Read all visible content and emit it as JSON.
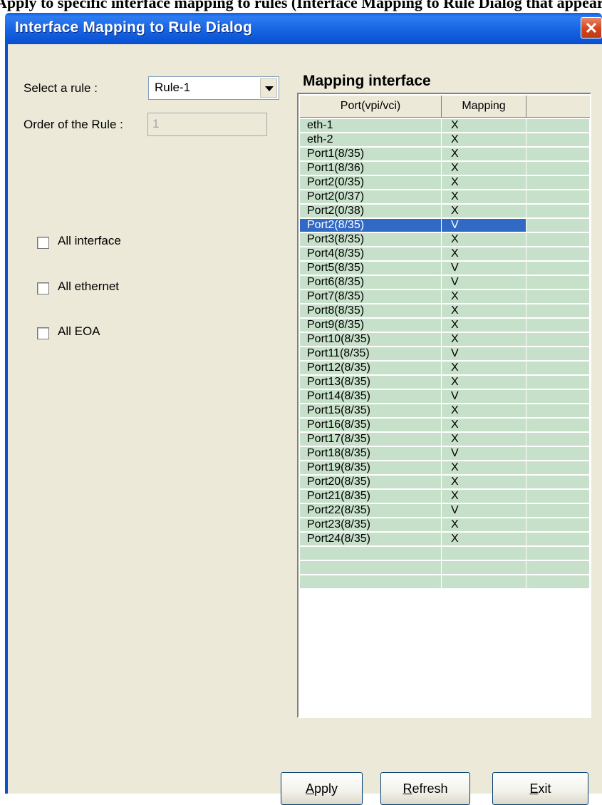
{
  "top_strip_text": "Apply to specific interface mapping to rules (Interface Mapping to Rule Dialog that appears)",
  "dialog": {
    "title": "Interface Mapping to Rule Dialog",
    "close_glyph": "✕"
  },
  "form": {
    "select_rule_label": "Select a rule :",
    "select_rule_value": "Rule-1",
    "order_label": "Order of the Rule :",
    "order_value": "1",
    "checkboxes": [
      {
        "label": "All interface",
        "checked": false
      },
      {
        "label": "All ethernet",
        "checked": false
      },
      {
        "label": "All EOA",
        "checked": false
      }
    ]
  },
  "mapping": {
    "title": "Mapping interface",
    "columns": [
      "Port(vpi/vci)",
      "Mapping",
      ""
    ],
    "selected_index": 7,
    "rows": [
      {
        "port": "eth-1",
        "mapping": "X"
      },
      {
        "port": "eth-2",
        "mapping": "X"
      },
      {
        "port": "Port1(8/35)",
        "mapping": "X"
      },
      {
        "port": "Port1(8/36)",
        "mapping": "X"
      },
      {
        "port": "Port2(0/35)",
        "mapping": "X"
      },
      {
        "port": "Port2(0/37)",
        "mapping": "X"
      },
      {
        "port": "Port2(0/38)",
        "mapping": "X"
      },
      {
        "port": "Port2(8/35)",
        "mapping": "V"
      },
      {
        "port": "Port3(8/35)",
        "mapping": "X"
      },
      {
        "port": "Port4(8/35)",
        "mapping": "X"
      },
      {
        "port": "Port5(8/35)",
        "mapping": "V"
      },
      {
        "port": "Port6(8/35)",
        "mapping": "V"
      },
      {
        "port": "Port7(8/35)",
        "mapping": "X"
      },
      {
        "port": "Port8(8/35)",
        "mapping": "X"
      },
      {
        "port": "Port9(8/35)",
        "mapping": "X"
      },
      {
        "port": "Port10(8/35)",
        "mapping": "X"
      },
      {
        "port": "Port11(8/35)",
        "mapping": "V"
      },
      {
        "port": "Port12(8/35)",
        "mapping": "X"
      },
      {
        "port": "Port13(8/35)",
        "mapping": "X"
      },
      {
        "port": "Port14(8/35)",
        "mapping": "V"
      },
      {
        "port": "Port15(8/35)",
        "mapping": "X"
      },
      {
        "port": "Port16(8/35)",
        "mapping": "X"
      },
      {
        "port": "Port17(8/35)",
        "mapping": "X"
      },
      {
        "port": "Port18(8/35)",
        "mapping": "V"
      },
      {
        "port": "Port19(8/35)",
        "mapping": "X"
      },
      {
        "port": "Port20(8/35)",
        "mapping": "X"
      },
      {
        "port": "Port21(8/35)",
        "mapping": "X"
      },
      {
        "port": "Port22(8/35)",
        "mapping": "V"
      },
      {
        "port": "Port23(8/35)",
        "mapping": "X"
      },
      {
        "port": "Port24(8/35)",
        "mapping": "X"
      },
      {
        "port": "",
        "mapping": ""
      },
      {
        "port": "",
        "mapping": ""
      },
      {
        "port": "",
        "mapping": ""
      }
    ]
  },
  "buttons": {
    "apply": {
      "mnemonic": "A",
      "rest": "pply"
    },
    "refresh": {
      "mnemonic": "R",
      "rest": "efresh"
    },
    "exit": {
      "mnemonic": "E",
      "rest": "xit"
    }
  },
  "colors": {
    "titlebar": "#0a50cb",
    "row_bg": "#c7e0c9",
    "selection": "#316ac5",
    "dialog_bg": "#ece9d8"
  }
}
